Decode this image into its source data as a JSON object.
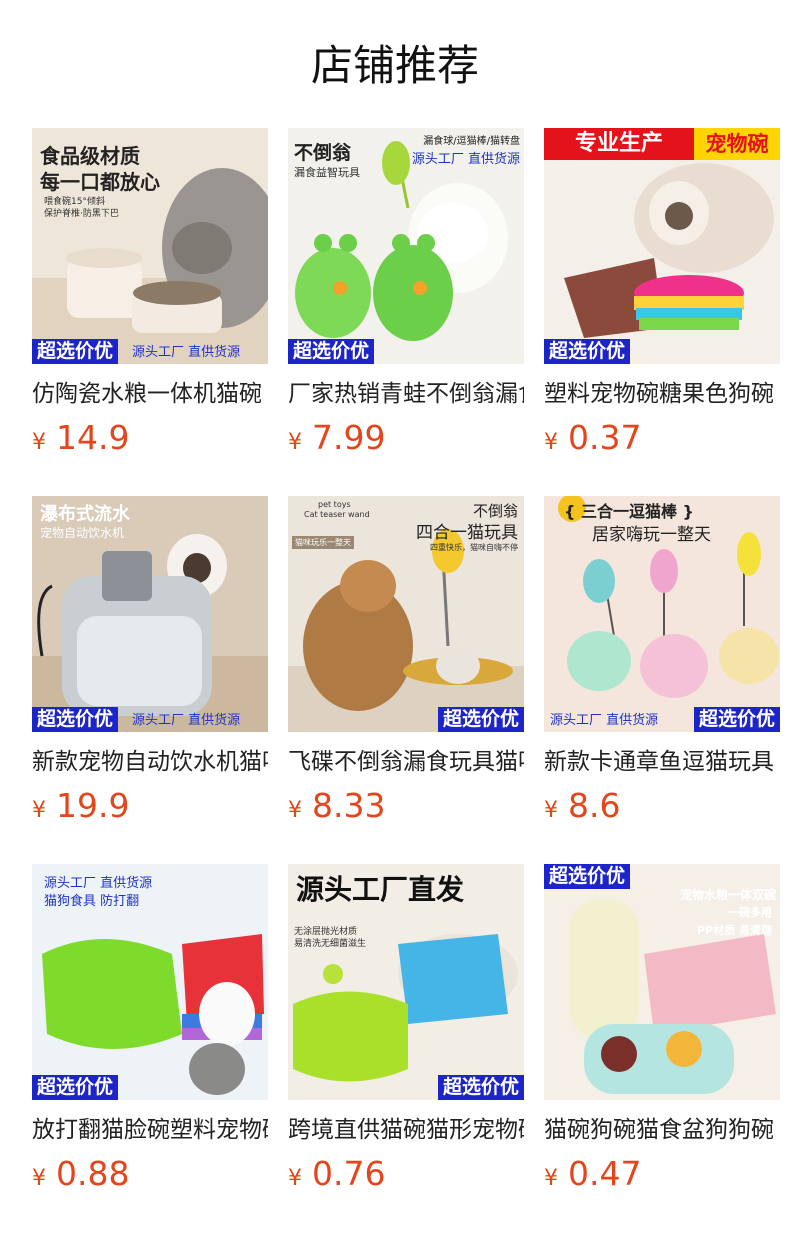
{
  "page": {
    "title": "店铺推荐"
  },
  "colors": {
    "price": "#e4461b",
    "badge_bg": "#1d25c9",
    "badge_text": "#ffffff"
  },
  "products": [
    {
      "name": "仿陶瓷水粮一体机猫碗",
      "currency": "¥",
      "price": "14.9",
      "badge": "超选价优",
      "overlay": {
        "h1": "食品级材质",
        "h2": "每一口都放心",
        "s1": "喂食碗15°倾斜",
        "s2": "保护脊椎·防黑下巴",
        "src": "源头工厂 直供货源"
      }
    },
    {
      "name": "厂家热销青蛙不倒翁漏食玩具",
      "currency": "¥",
      "price": "7.99",
      "badge": "超选价优",
      "overlay": {
        "h1": "不倒翁",
        "s1": "漏食益智玩具",
        "tags": "漏食球/逗猫棒/猫转盘",
        "src": "源头工厂 直供货源"
      }
    },
    {
      "name": "塑料宠物碗糖果色狗碗",
      "currency": "¥",
      "price": "0.37",
      "badge": "超选价优",
      "overlay": {
        "h1": "专业生产",
        "h2": "宠物碗"
      }
    },
    {
      "name": "新款宠物自动饮水机猫咪",
      "currency": "¥",
      "price": "19.9",
      "badge": "超选价优",
      "overlay": {
        "h1": "瀑布式流水",
        "s1": "宠物自动饮水机",
        "src": "源头工厂 直供货源"
      }
    },
    {
      "name": "飞碟不倒翁漏食玩具猫咪",
      "currency": "¥",
      "price": "8.33",
      "badge": "超选价优",
      "overlay": {
        "h1": "不倒翁",
        "h2": "四合一猫玩具",
        "s1": "四重快乐，猫咪自嗨不停",
        "s2": "pet toys",
        "s3": "Cat teaser wand",
        "s4": "猫咪玩乐一整天"
      }
    },
    {
      "name": "新款卡通章鱼逗猫玩具",
      "currency": "¥",
      "price": "8.6",
      "badge": "超选价优",
      "overlay": {
        "h1": "{ 三合一逗猫棒 }",
        "h2": "居家嗨玩一整天",
        "src": "源头工厂 直供货源"
      }
    },
    {
      "name": "放打翻猫脸碗塑料宠物碗",
      "currency": "¥",
      "price": "0.88",
      "badge": "超选价优",
      "overlay": {
        "s1": "源头工厂 直供货源",
        "s2": "猫狗食具 防打翻"
      }
    },
    {
      "name": "跨境直供猫碗猫形宠物碗",
      "currency": "¥",
      "price": "0.76",
      "badge": "超选价优",
      "overlay": {
        "h1": "源头工厂直发",
        "s1": "无涂层抛光材质",
        "s2": "易清洗无细菌滋生"
      }
    },
    {
      "name": "猫碗狗碗猫食盆狗狗碗",
      "currency": "¥",
      "price": "0.47",
      "badge": "超选价优",
      "overlay": {
        "h1": "宠物水粮一体双碗",
        "h2": "一碗多用",
        "s1": "PP材质 易清理"
      }
    }
  ]
}
